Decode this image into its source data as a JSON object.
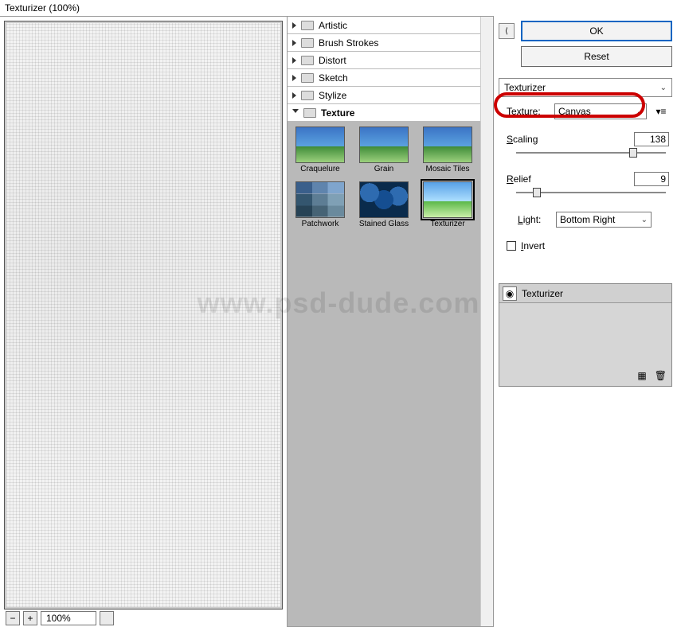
{
  "window": {
    "title": "Texturizer (100%)"
  },
  "zoom": {
    "value": "100%"
  },
  "filter_groups": [
    {
      "label": "Artistic",
      "open": false
    },
    {
      "label": "Brush Strokes",
      "open": false
    },
    {
      "label": "Distort",
      "open": false
    },
    {
      "label": "Sketch",
      "open": false
    },
    {
      "label": "Stylize",
      "open": false
    },
    {
      "label": "Texture",
      "open": true
    }
  ],
  "texture_thumbs": [
    {
      "label": "Craquelure"
    },
    {
      "label": "Grain"
    },
    {
      "label": "Mosaic Tiles"
    },
    {
      "label": "Patchwork"
    },
    {
      "label": "Stained Glass"
    },
    {
      "label": "Texturizer",
      "selected": true
    }
  ],
  "buttons": {
    "ok": "OK",
    "reset": "Reset"
  },
  "section": {
    "current_filter": "Texturizer"
  },
  "settings": {
    "texture_label": "Texture:",
    "texture_value": "Canvas",
    "scaling_label": "Scaling",
    "scaling_value": "138",
    "relief_label": "Relief",
    "relief_value": "9",
    "light_label": "Light:",
    "light_value": "Bottom Right",
    "invert_label": "Invert"
  },
  "layer": {
    "name": "Texturizer"
  },
  "watermark": "www.psd-dude.com"
}
